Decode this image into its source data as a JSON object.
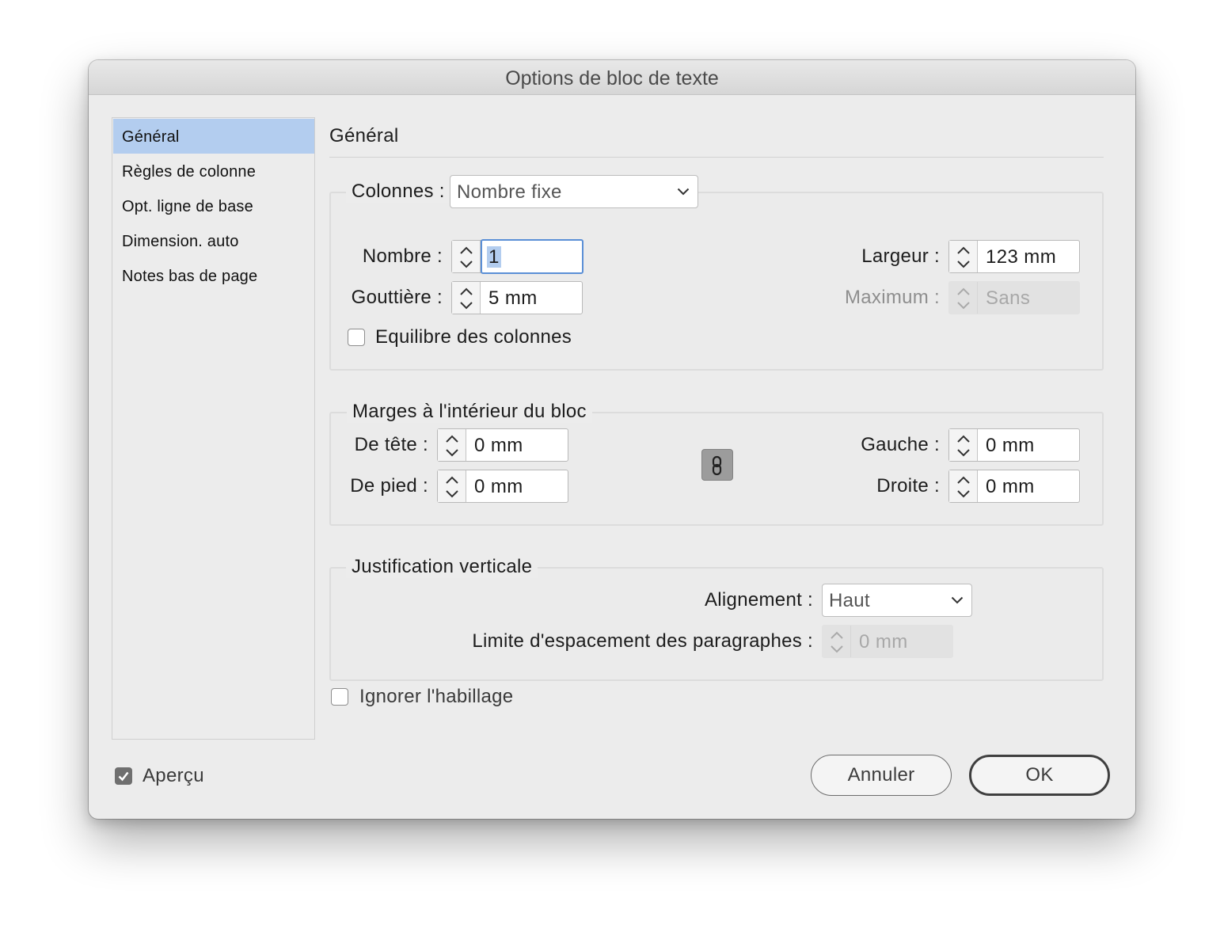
{
  "window": {
    "title": "Options de bloc de texte"
  },
  "sidebar": {
    "items": [
      {
        "label": "Général",
        "active": true
      },
      {
        "label": "Règles de colonne",
        "active": false
      },
      {
        "label": "Opt. ligne de base",
        "active": false
      },
      {
        "label": "Dimension. auto",
        "active": false
      },
      {
        "label": "Notes bas de page",
        "active": false
      }
    ]
  },
  "panel": {
    "title": "Général"
  },
  "columns": {
    "label": "Colonnes :",
    "type_value": "Nombre fixe",
    "number_label": "Nombre :",
    "number_value": "1",
    "gutter_label": "Gouttière :",
    "gutter_value": "5 mm",
    "width_label": "Largeur :",
    "width_value": "123 mm",
    "max_label": "Maximum :",
    "max_value": "Sans",
    "balance_label": "Equilibre des colonnes",
    "balance_checked": false
  },
  "insets": {
    "legend": "Marges à l'intérieur du bloc",
    "top_label": "De tête :",
    "top_value": "0 mm",
    "bottom_label": "De pied :",
    "bottom_value": "0 mm",
    "left_label": "Gauche :",
    "left_value": "0 mm",
    "right_label": "Droite :",
    "right_value": "0 mm",
    "link_icon": "chain-link-icon"
  },
  "vertical": {
    "legend": "Justification verticale",
    "align_label": "Alignement :",
    "align_value": "Haut",
    "spacing_label": "Limite d'espacement des paragraphes :",
    "spacing_value": "0 mm"
  },
  "ignore_wrap": {
    "label": "Ignorer l'habillage",
    "checked": false
  },
  "preview": {
    "label": "Aperçu",
    "checked": true
  },
  "buttons": {
    "cancel": "Annuler",
    "ok": "OK"
  },
  "colors": {
    "selection": "#b3cdef",
    "focus_ring": "#5a8fd6",
    "dialog_bg": "#ececec"
  }
}
